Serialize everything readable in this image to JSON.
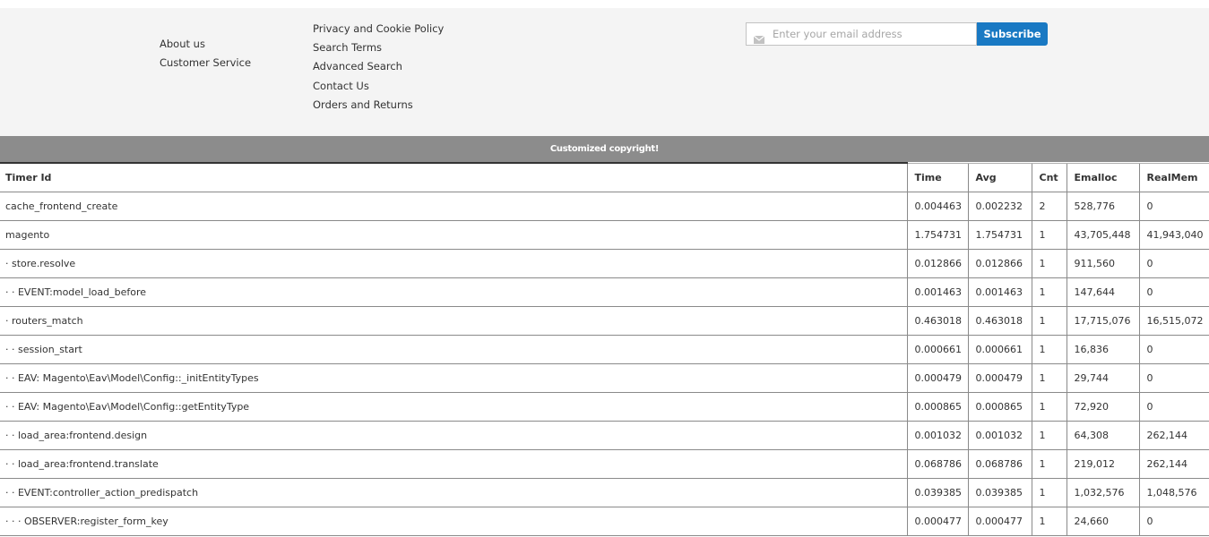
{
  "footer": {
    "links_col1": [
      "About us",
      "Customer Service"
    ],
    "links_col2": [
      "Privacy and Cookie Policy",
      "Search Terms",
      "Advanced Search",
      "Contact Us",
      "Orders and Returns"
    ],
    "newsletter": {
      "email_value": "",
      "email_placeholder": "Enter your email address",
      "icon": "envelope-icon",
      "subscribe_label": "Subscribe",
      "accent_color": "#1979c3"
    }
  },
  "copyright": "Customized copyright!",
  "profiler": {
    "columns": [
      "Timer Id",
      "Time",
      "Avg",
      "Cnt",
      "Emalloc",
      "RealMem"
    ],
    "rows": [
      [
        "cache_frontend_create",
        "0.004463",
        "0.002232",
        "2",
        "528,776",
        "0"
      ],
      [
        "magento",
        "1.754731",
        "1.754731",
        "1",
        "43,705,448",
        "41,943,040"
      ],
      [
        "· store.resolve",
        "0.012866",
        "0.012866",
        "1",
        "911,560",
        "0"
      ],
      [
        "· · EVENT:model_load_before",
        "0.001463",
        "0.001463",
        "1",
        "147,644",
        "0"
      ],
      [
        "· routers_match",
        "0.463018",
        "0.463018",
        "1",
        "17,715,076",
        "16,515,072"
      ],
      [
        "· · session_start",
        "0.000661",
        "0.000661",
        "1",
        "16,836",
        "0"
      ],
      [
        "· · EAV: Magento\\Eav\\Model\\Config::_initEntityTypes",
        "0.000479",
        "0.000479",
        "1",
        "29,744",
        "0"
      ],
      [
        "· · EAV: Magento\\Eav\\Model\\Config::getEntityType",
        "0.000865",
        "0.000865",
        "1",
        "72,920",
        "0"
      ],
      [
        "· · load_area:frontend.design",
        "0.001032",
        "0.001032",
        "1",
        "64,308",
        "262,144"
      ],
      [
        "· · load_area:frontend.translate",
        "0.068786",
        "0.068786",
        "1",
        "219,012",
        "262,144"
      ],
      [
        "· · EVENT:controller_action_predispatch",
        "0.039385",
        "0.039385",
        "1",
        "1,032,576",
        "1,048,576"
      ],
      [
        "· · · OBSERVER:register_form_key",
        "0.000477",
        "0.000477",
        "1",
        "24,660",
        "0"
      ]
    ]
  }
}
